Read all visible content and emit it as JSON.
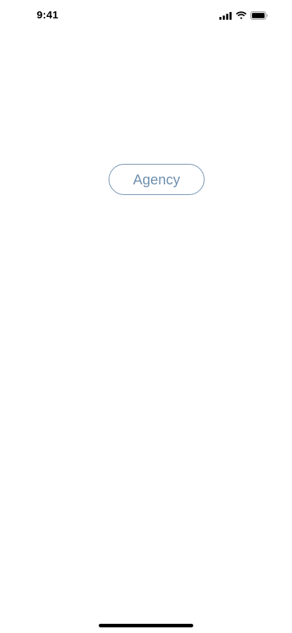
{
  "status_bar": {
    "time": "9:41",
    "icons": [
      "cellular-signal-icon",
      "wifi-icon",
      "battery-icon"
    ]
  },
  "main": {
    "agency_button_label": "Agency"
  },
  "colors": {
    "button_border": "#6b8cac",
    "button_text": "#6f8faf",
    "background": "#ffffff"
  }
}
